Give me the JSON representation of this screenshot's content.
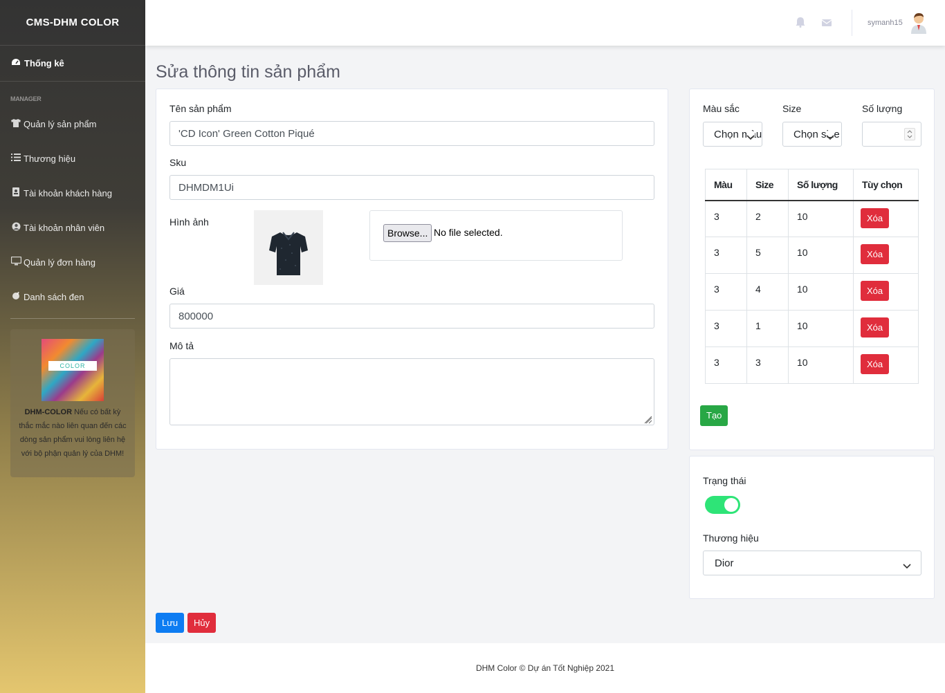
{
  "sidebar": {
    "brand": "CMS-DHM COLOR",
    "dashboard": "Thống kê",
    "heading": "MANAGER",
    "items": [
      {
        "label": "Quản lý sản phẩm",
        "icon": "shirt-icon"
      },
      {
        "label": "Thương hiệu",
        "icon": "list-icon"
      },
      {
        "label": "Tài khoản khách hàng",
        "icon": "address-book-icon"
      },
      {
        "label": "Tài khoản nhân viên",
        "icon": "user-circle-icon"
      },
      {
        "label": "Quản lý đơn hàng",
        "icon": "desktop-icon"
      },
      {
        "label": "Danh sách đen",
        "icon": "blacklist-icon"
      }
    ],
    "promo": {
      "logo_text": "COLOR",
      "brand": "DHM-COLOR",
      "text": " Nếu có bất kỳ thắc mắc nào liên quan đến các dòng sản phẩm vui lòng liên hệ với bộ phận quản lý của DHM!"
    }
  },
  "topbar": {
    "username": "symanh15"
  },
  "page": {
    "title": "Sửa thông tin sản phẩm"
  },
  "form": {
    "name_label": "Tên sản phẩm",
    "name_value": "'CD Icon' Green Cotton Piqué",
    "sku_label": "Sku",
    "sku_value": "DHMDM1Ui",
    "image_label": "Hình ảnh",
    "browse_label": "Browse...",
    "no_file": "No file selected.",
    "price_label": "Giá",
    "price_value": "800000",
    "desc_label": "Mô tả",
    "desc_value": ""
  },
  "variants": {
    "color_label": "Màu sắc",
    "color_select": "Chọn màu",
    "size_label": "Size",
    "size_select": "Chọn size",
    "qty_label": "Số lượng",
    "headers": [
      "Màu",
      "Size",
      "Số lượng",
      "Tùy chọn"
    ],
    "rows": [
      {
        "color": "3",
        "size": "2",
        "qty": "10",
        "action": "Xóa"
      },
      {
        "color": "3",
        "size": "5",
        "qty": "10",
        "action": "Xóa"
      },
      {
        "color": "3",
        "size": "4",
        "qty": "10",
        "action": "Xóa"
      },
      {
        "color": "3",
        "size": "1",
        "qty": "10",
        "action": "Xóa"
      },
      {
        "color": "3",
        "size": "3",
        "qty": "10",
        "action": "Xóa"
      }
    ],
    "create_label": "Tạo"
  },
  "status": {
    "label": "Trạng thái",
    "enabled": true,
    "brand_label": "Thương hiệu",
    "brand_value": "Dior"
  },
  "actions": {
    "save": "Lưu",
    "cancel": "Hủy"
  },
  "footer": {
    "text": "DHM Color © Dự án Tốt Nghiệp 2021"
  },
  "colors": {
    "primary": "#0d7cf2",
    "danger": "#e02d3c",
    "success": "#28a745",
    "toggle_on": "#2ee477"
  }
}
